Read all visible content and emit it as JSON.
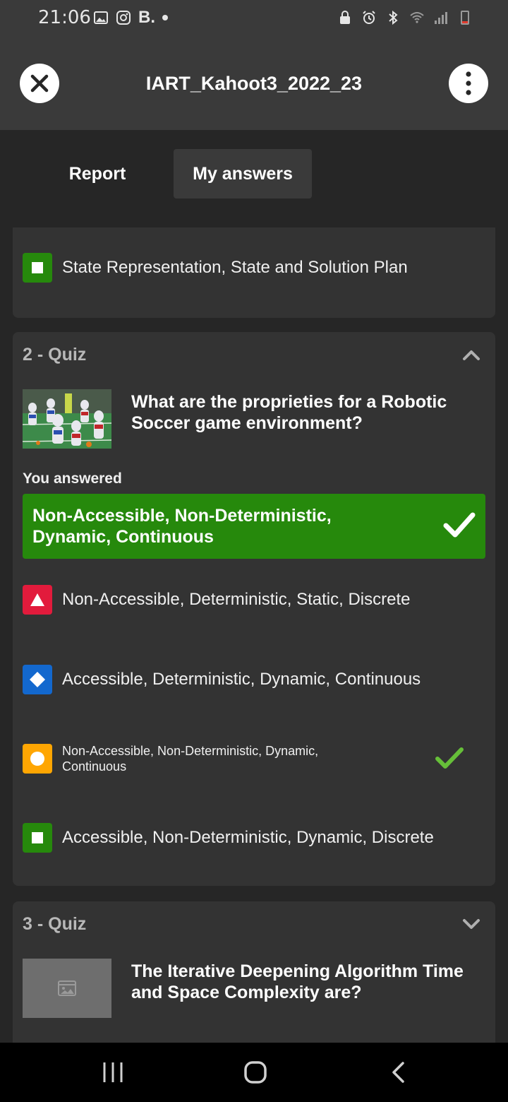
{
  "status_bar": {
    "time": "21:06",
    "b_label": "B.",
    "icons": [
      "gallery-icon",
      "instagram-icon",
      "lock-icon",
      "alarm-icon",
      "bluetooth-icon",
      "wifi-icon",
      "signal-icon",
      "battery-icon"
    ]
  },
  "header": {
    "title": "IART_Kahoot3_2022_23",
    "close_icon": "close-icon",
    "more_icon": "more-vertical-icon"
  },
  "tabs": [
    {
      "label": "Report",
      "selected": false
    },
    {
      "label": "My answers",
      "selected": true
    }
  ],
  "card1": {
    "answer": {
      "shape": "square",
      "color": "#26890c",
      "text": "State Representation, State and Solution Plan"
    }
  },
  "question2": {
    "header": "2 - Quiz",
    "expanded": true,
    "question": "What are the proprieties for a Robotic Soccer game environment?",
    "you_answered_label": "You answered",
    "selected_answer": "Non-Accessible, Non-Deterministic, Dynamic, Continuous",
    "answers": [
      {
        "shape": "triangle",
        "color": "#e21b3c",
        "text": "Non-Accessible, Deterministic, Static, Discrete",
        "correct": false
      },
      {
        "shape": "diamond",
        "color": "#1368ce",
        "text": "Accessible, Deterministic, Dynamic, Continuous",
        "correct": false
      },
      {
        "shape": "circle",
        "color": "#ffa602",
        "text": "Non-Accessible, Non-Deterministic, Dynamic, Continuous",
        "correct": true
      },
      {
        "shape": "square",
        "color": "#26890c",
        "text": "Accessible, Non-Deterministic, Dynamic, Discrete",
        "correct": false
      }
    ]
  },
  "question3": {
    "header": "3 - Quiz",
    "expanded": false,
    "question": "The Iterative Deepening Algorithm Time and Space Complexity are?"
  },
  "colors": {
    "correct_green": "#26890c",
    "check_green": "#66bf39",
    "card_bg": "#333333",
    "page_bg": "#262626"
  }
}
